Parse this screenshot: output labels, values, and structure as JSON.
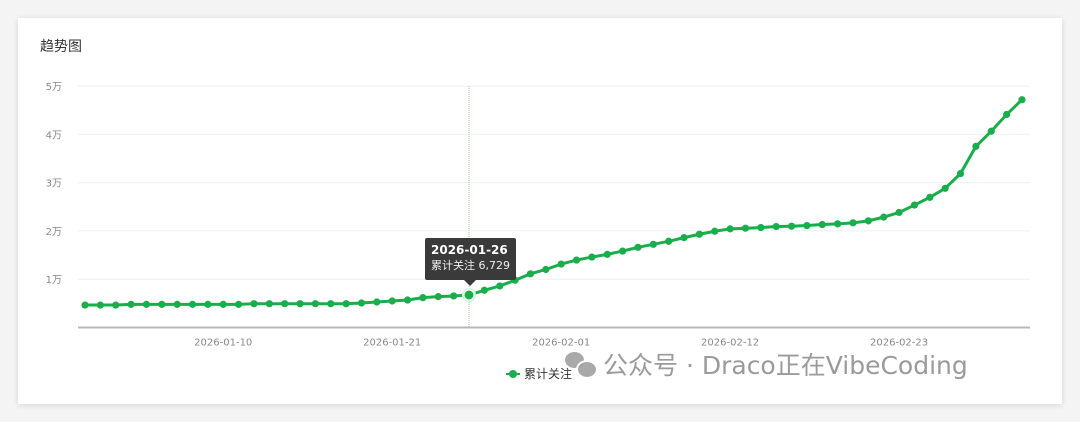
{
  "card": {
    "title": "趋势图"
  },
  "tooltip": {
    "date": "2026-01-26",
    "label": "累计关注 6,729"
  },
  "watermark": {
    "text": "公众号 · Draco正在VibeCoding",
    "icon": "wechat-icon"
  },
  "chart_data": {
    "type": "line",
    "title": "趋势图",
    "xlabel": "",
    "ylabel": "",
    "ylim": [
      0,
      50000
    ],
    "y_ticks": [
      {
        "value": 10000,
        "label": "1万"
      },
      {
        "value": 20000,
        "label": "2万"
      },
      {
        "value": 30000,
        "label": "3万"
      },
      {
        "value": 40000,
        "label": "4万"
      },
      {
        "value": 50000,
        "label": "5万"
      }
    ],
    "x_start": "2026-01-01",
    "x_ticks": [
      "2026-01-10",
      "2026-01-21",
      "2026-02-01",
      "2026-02-12",
      "2026-02-23"
    ],
    "grid": true,
    "legend": "bottom-center",
    "color": "#1aad4b",
    "highlight": {
      "date": "2026-01-26",
      "value": 6729
    },
    "series": [
      {
        "name": "累计关注",
        "values": [
          4650,
          4650,
          4650,
          4790,
          4790,
          4790,
          4790,
          4790,
          4790,
          4790,
          4790,
          4930,
          4930,
          4930,
          4930,
          4930,
          4930,
          4930,
          5070,
          5280,
          5490,
          5690,
          6180,
          6390,
          6530,
          6729,
          7710,
          8610,
          9790,
          11110,
          12010,
          13130,
          13960,
          14580,
          15140,
          15830,
          16600,
          17220,
          17850,
          18610,
          19310,
          19930,
          20420,
          20560,
          20690,
          20900,
          20970,
          21110,
          21320,
          21460,
          21670,
          22080,
          22850,
          23820,
          25350,
          26940,
          28820,
          31880,
          37500,
          40630,
          44100,
          47150
        ]
      }
    ]
  }
}
